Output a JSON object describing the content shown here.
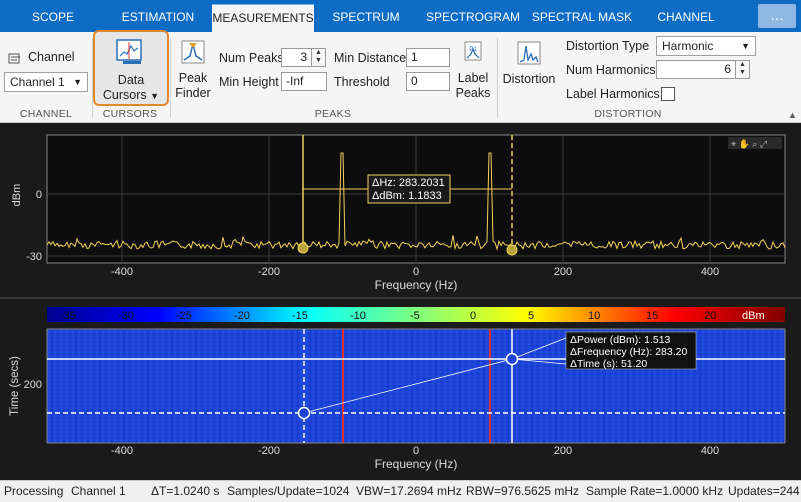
{
  "tabs": [
    {
      "label": "SCOPE"
    },
    {
      "label": "ESTIMATION"
    },
    {
      "label": "MEASUREMENTS"
    },
    {
      "label": "SPECTRUM"
    },
    {
      "label": "SPECTROGRAM"
    },
    {
      "label": "SPECTRAL MASK"
    },
    {
      "label": "CHANNEL MEAS..."
    }
  ],
  "tab_more": "…",
  "ribbon": {
    "channel": {
      "label": "Channel",
      "value": "Channel 1",
      "section": "CHANNEL"
    },
    "cursors": {
      "label_line1": "Data",
      "label_line2": "Cursors",
      "section": "CURSORS"
    },
    "peaks": {
      "peak_finder_line1": "Peak",
      "peak_finder_line2": "Finder",
      "num_peaks_label": "Num Peaks",
      "num_peaks_value": "3",
      "min_height_label": "Min Height",
      "min_height_value": "-Inf",
      "min_distance_label": "Min Distance",
      "min_distance_value": "1",
      "threshold_label": "Threshold",
      "threshold_value": "0",
      "label_peaks_line1": "Label",
      "label_peaks_line2": "Peaks",
      "section": "PEAKS"
    },
    "distortion": {
      "button_label": "Distortion",
      "type_label": "Distortion Type",
      "type_value": "Harmonic",
      "num_harmonics_label": "Num Harmonics",
      "num_harmonics_value": "6",
      "label_harmonics_label": "Label Harmonics",
      "section": "DISTORTION"
    }
  },
  "spectrum": {
    "ylabel": "dBm",
    "xlabel": "Frequency (Hz)",
    "yticks": [
      "0",
      "-30"
    ],
    "xticks": [
      "-400",
      "-200",
      "0",
      "200",
      "400"
    ],
    "cursor_readout": {
      "line1": "ΔHz: 283.2031",
      "line2": "ΔdBm: 1.1833"
    }
  },
  "spectrogram": {
    "colorbar_ticks": [
      "-35",
      "-30",
      "-25",
      "-20",
      "-15",
      "-10",
      "-5",
      "0",
      "5",
      "10",
      "15",
      "20"
    ],
    "colorbar_unit": "dBm",
    "ylabel": "Time (secs)",
    "yticks": [
      "200"
    ],
    "xlabel": "Frequency (Hz)",
    "xticks": [
      "-400",
      "-200",
      "0",
      "200",
      "400"
    ],
    "cursor_readout": {
      "line1": "ΔPower (dBm): 1.513",
      "line2": "ΔFrequency (Hz): 283.20",
      "line3": "ΔTime (s): 51.20"
    }
  },
  "status": {
    "state": "Processing",
    "channel": "Channel 1",
    "dt": "ΔT=1.0240 s",
    "samples": "Samples/Update=1024",
    "vbw": "VBW=17.2694 mHz",
    "rbw": "RBW=976.5625 mHz",
    "sample_rate": "Sample Rate=1.0000 kHz",
    "updates": "Updates=244"
  },
  "colors": {
    "tabbar": "#0e6cc4",
    "trace": "#f2d15a",
    "spectrogram_bg": "#1c3fd6",
    "highlight": "#e08a2c"
  },
  "icons": [
    "data-cursors-icon",
    "peak-finder-icon",
    "label-peaks-icon",
    "distortion-icon",
    "plot-toolbar-icons"
  ]
}
